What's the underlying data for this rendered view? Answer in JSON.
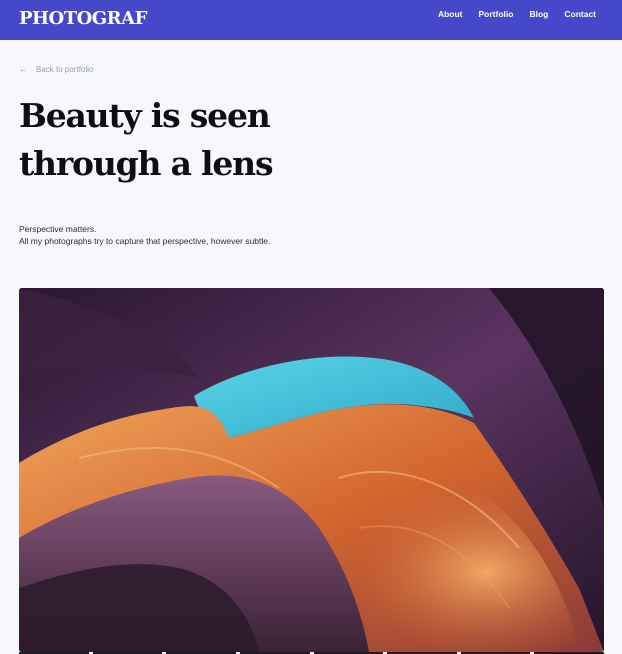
{
  "brand": {
    "logo": "PHOTOGRAF"
  },
  "nav": {
    "items": [
      "About",
      "Portfolio",
      "Blog",
      "Contact"
    ]
  },
  "back_link": {
    "label": "Back to portfolio"
  },
  "hero": {
    "title_line1": "Beauty is seen",
    "title_line2": "through a lens",
    "desc_line1": "Perspective matters.",
    "desc_line2": "All my photographs try to capture that perspective, however subtle."
  },
  "icons": {
    "back": "arrow-left-icon"
  },
  "colors": {
    "nav_bg": "#4549c9",
    "page_bg": "#f7f8fc",
    "heading": "#0d0d12"
  }
}
